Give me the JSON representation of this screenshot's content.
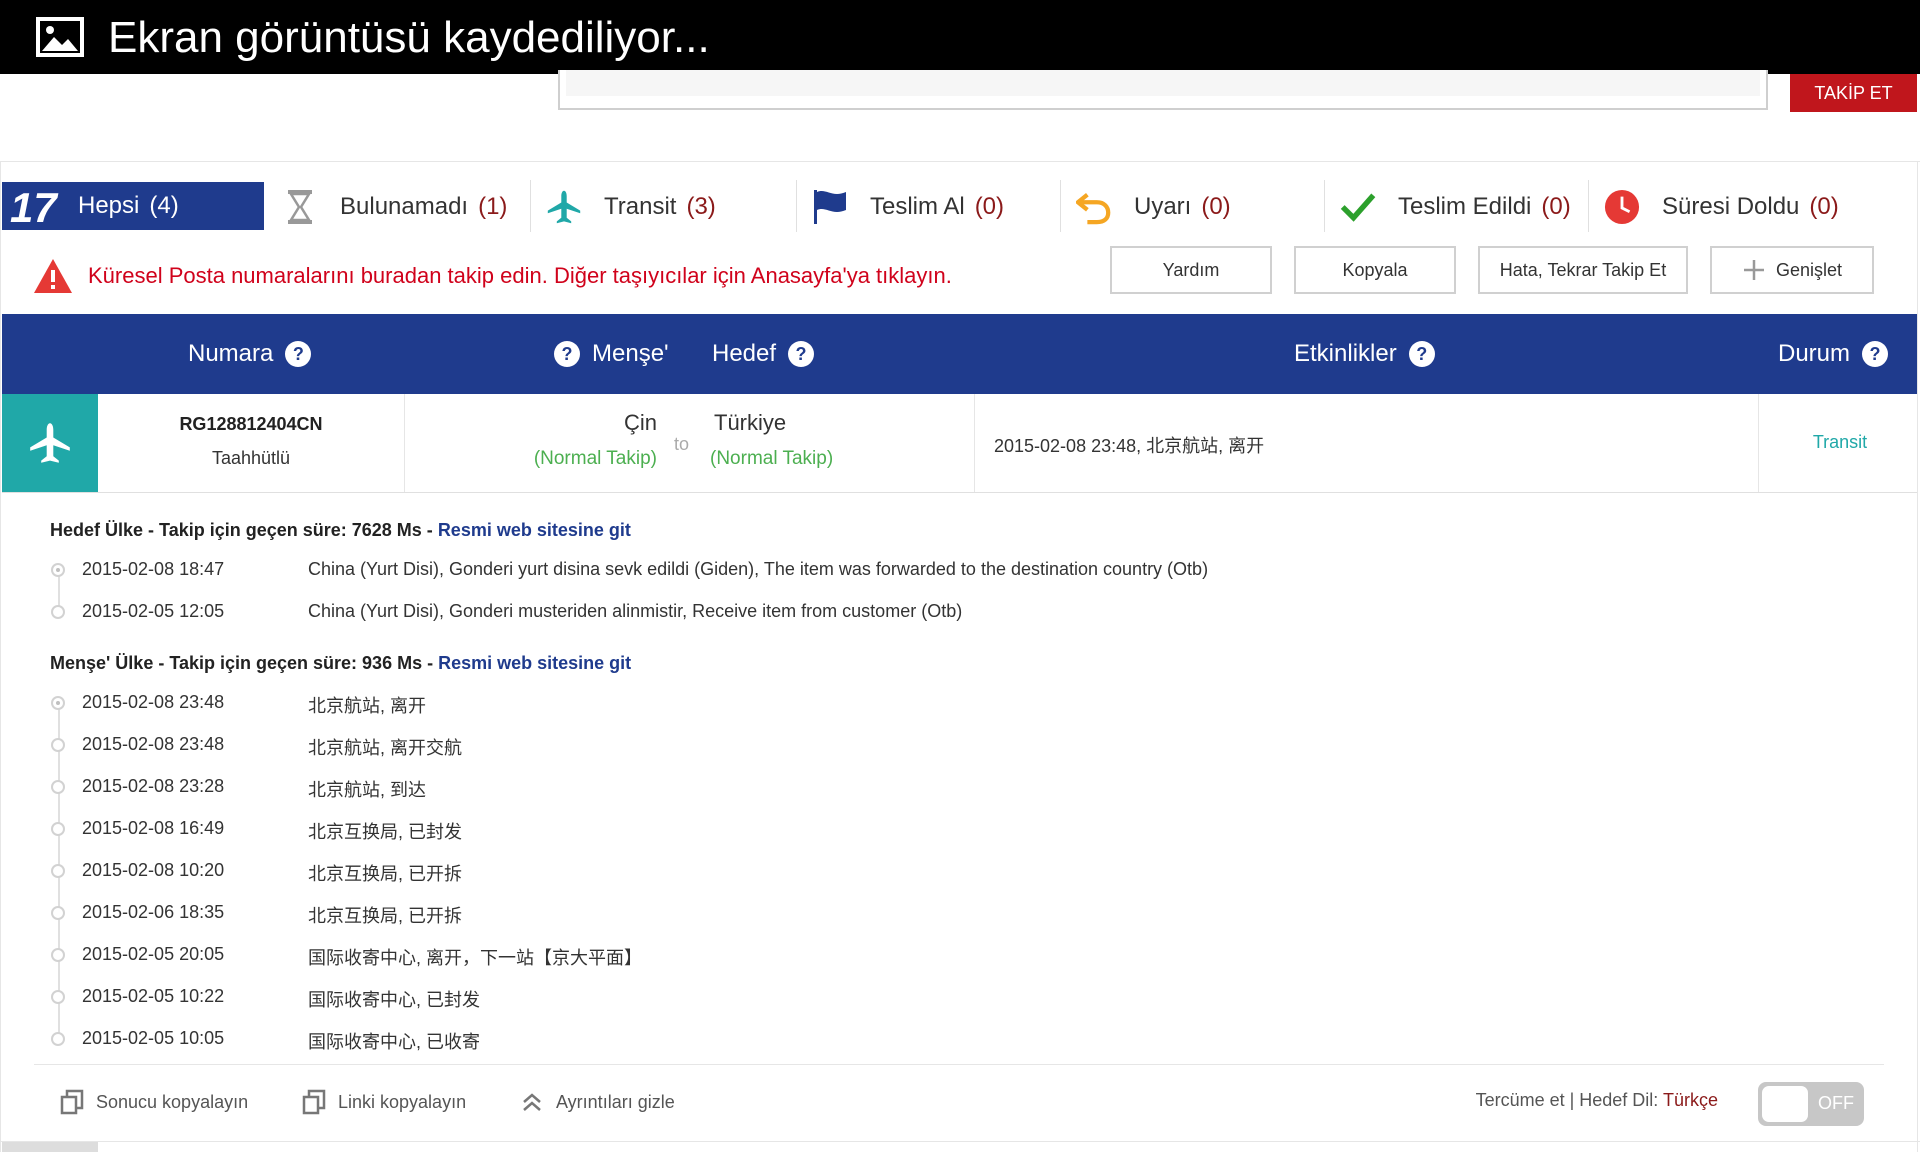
{
  "notification": {
    "title": "Ekran görüntüsü kaydediliyor..."
  },
  "top": {
    "follow_button": "TAKİP ET"
  },
  "tabs": [
    {
      "label": "Hepsi",
      "count": "(4)"
    },
    {
      "label": "Bulunamadı",
      "count": "(1)"
    },
    {
      "label": "Transit",
      "count": "(3)"
    },
    {
      "label": "Teslim Al",
      "count": "(0)"
    },
    {
      "label": "Uyarı",
      "count": "(0)"
    },
    {
      "label": "Teslim Edildi",
      "count": "(0)"
    },
    {
      "label": "Süresi Doldu",
      "count": "(0)"
    }
  ],
  "logo_text": "17",
  "warning": "Küresel Posta numaralarını buradan takip edin. Diğer taşıyıcılar için Anasayfa'ya tıklayın.",
  "actions": {
    "help": "Yardım",
    "copy": "Kopyala",
    "retry": "Hata, Tekrar Takip Et",
    "expand": "Genişlet"
  },
  "table_header": {
    "number": "Numara",
    "origin": "Menşe'",
    "destination": "Hedef",
    "events": "Etkinlikler",
    "status": "Durum",
    "help_mark": "?"
  },
  "result": {
    "tracking_number": "RG128812404CN",
    "type": "Taahhütlü",
    "origin": "Çin",
    "origin_mode": "(Normal Takip)",
    "to": "to",
    "destination": "Türkiye",
    "destination_mode": "(Normal Takip)",
    "latest_event": "2015-02-08 23:48, 北京航站, 离开",
    "status": "Transit"
  },
  "destination_section": {
    "title": "Hedef Ülke - Takip için geçen süre: 7628 Ms - ",
    "link": "Resmi web sitesine git",
    "events": [
      {
        "date": "2015-02-08 18:47",
        "desc": "China (Yurt Disi), Gonderi yurt disina sevk edildi (Giden), The item was forwarded to the destination country (Otb)"
      },
      {
        "date": "2015-02-05 12:05",
        "desc": "China (Yurt Disi), Gonderi musteriden alinmistir, Receive item from customer (Otb)"
      }
    ]
  },
  "origin_section": {
    "title": "Menşe' Ülke - Takip için geçen süre: 936 Ms - ",
    "link": "Resmi web sitesine git",
    "events": [
      {
        "date": "2015-02-08 23:48",
        "desc": "北京航站, 离开"
      },
      {
        "date": "2015-02-08 23:48",
        "desc": "北京航站, 离开交航"
      },
      {
        "date": "2015-02-08 23:28",
        "desc": "北京航站, 到达"
      },
      {
        "date": "2015-02-08 16:49",
        "desc": "北京互换局, 已封发"
      },
      {
        "date": "2015-02-08 10:20",
        "desc": "北京互换局, 已开拆"
      },
      {
        "date": "2015-02-06 18:35",
        "desc": "北京互换局, 已开拆"
      },
      {
        "date": "2015-02-05 20:05",
        "desc": "国际收寄中心, 离开，下一站【京大平面】"
      },
      {
        "date": "2015-02-05 10:22",
        "desc": "国际收寄中心, 已封发"
      },
      {
        "date": "2015-02-05 10:05",
        "desc": "国际收寄中心, 已收寄"
      }
    ]
  },
  "footer": {
    "copy_result": "Sonucu kopyalayın",
    "copy_link": "Linki kopyalayın",
    "hide_details": "Ayrıntıları gizle",
    "translate_label": "Tercüme et | Hedef Dil: ",
    "translate_lang": "Türkçe",
    "toggle_label": "OFF"
  },
  "colors": {
    "primary": "#1f3b8d",
    "accent_red": "#c0161c",
    "teal": "#20a8a8",
    "green": "#4caf50"
  }
}
